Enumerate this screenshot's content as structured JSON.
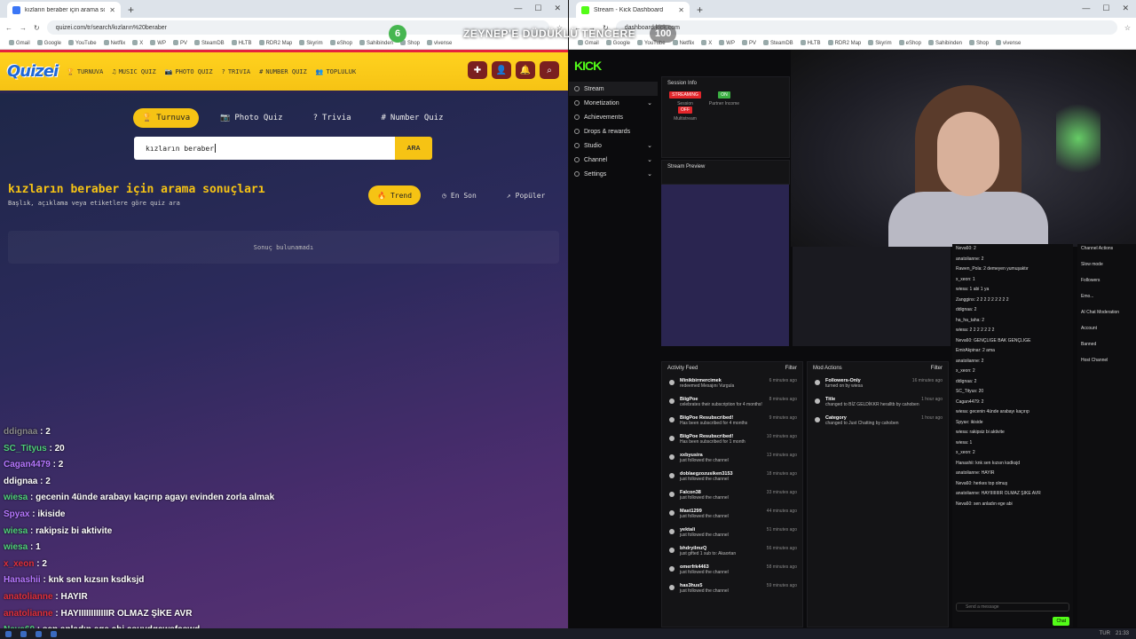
{
  "left_browser": {
    "tab_title": "kızların beraber için arama sonu...",
    "url": "quizei.com/tr/search/kızların%20beraber",
    "bookmarks": [
      "Gmail",
      "Google",
      "YouTube",
      "Netflix",
      "X",
      "WP",
      "PV",
      "SteamDB",
      "HLTB",
      "RDR2 Map",
      "Skyrim",
      "eShop",
      "Sahibinden",
      "Shop",
      "vivense"
    ]
  },
  "site": {
    "logo": "Quizei",
    "nav": [
      {
        "icon": "🏆",
        "label": "TURNUVA"
      },
      {
        "icon": "♫",
        "label": "MUSIC QUIZ"
      },
      {
        "icon": "📷",
        "label": "PHOTO QUIZ"
      },
      {
        "icon": "?",
        "label": "TRIVIA"
      },
      {
        "icon": "#",
        "label": "NUMBER QUIZ"
      },
      {
        "icon": "👥",
        "label": "TOPLULUK"
      }
    ],
    "tabs": [
      {
        "icon": "🏆",
        "label": "Turnuva",
        "active": true
      },
      {
        "icon": "📷",
        "label": "Photo Quiz",
        "active": false
      },
      {
        "icon": "?",
        "label": "Trivia",
        "active": false
      },
      {
        "icon": "#",
        "label": "Number Quiz",
        "active": false
      }
    ],
    "search_value": "kızların beraber",
    "search_button": "ARA",
    "results_title": "kızların beraber için arama sonuçları",
    "results_subtitle": "Başlık, açıklama veya etiketlere göre quiz ara",
    "sorts": [
      {
        "icon": "🔥",
        "label": "Trend",
        "active": true
      },
      {
        "icon": "◷",
        "label": "En Son",
        "active": false
      },
      {
        "icon": "↗",
        "label": "Popüler",
        "active": false
      }
    ],
    "no_results": "Sonuç bulunamadı"
  },
  "overlay": {
    "left_count": "6",
    "text": "ZEYNEP'E DÜDÜKLÜ TENCERE",
    "right_count": "100"
  },
  "chat_overlay": [
    {
      "user": "ddignaa",
      "msg": "2",
      "color": "#8a8a8a"
    },
    {
      "user": "SC_Tityus",
      "msg": "20",
      "color": "#4fd07a"
    },
    {
      "user": "Cagan4479",
      "msg": "2",
      "color": "#b677ff"
    },
    {
      "user": "ddignaa",
      "msg": "2",
      "color": "#ffffff"
    },
    {
      "user": "wiesa",
      "msg": "gecenin 4ünde arabayı kaçırıp agayı evinden zorla almak",
      "color": "#4fd07a"
    },
    {
      "user": "Spyax",
      "msg": "ikiside",
      "color": "#b677ff"
    },
    {
      "user": "wiesa",
      "msg": "rakipsiz bi aktivite",
      "color": "#4fd07a"
    },
    {
      "user": "wiesa",
      "msg": "1",
      "color": "#4fd07a"
    },
    {
      "user": "x_xeon",
      "msg": "2",
      "color": "#e0303a"
    },
    {
      "user": "Hanashii",
      "msg": "knk sen kızsın ksdksjd",
      "color": "#b677ff"
    },
    {
      "user": "anatolianne",
      "msg": "HAYIR",
      "color": "#e0303a"
    },
    {
      "user": "anatolianne",
      "msg": "HAYIIIIIIIIIIIIR OLMAZ ŞİKE AVR",
      "color": "#e0303a"
    },
    {
      "user": "Neva60",
      "msg": "sen anladın ege abi asuydqawsfaswd",
      "color": "#4fd07a"
    }
  ],
  "right_browser": {
    "tab_title": "Stream - Kick Dashboard",
    "url": "dashboard.kick.com"
  },
  "kick": {
    "logo": "KICK",
    "menu": [
      {
        "label": "Stream",
        "active": true,
        "chev": ""
      },
      {
        "label": "Monetization",
        "active": false,
        "chev": "⌄"
      },
      {
        "label": "Achievements",
        "active": false,
        "chev": ""
      },
      {
        "label": "Drops & rewards",
        "active": false,
        "chev": ""
      },
      {
        "label": "Studio",
        "active": false,
        "chev": "⌄"
      },
      {
        "label": "Channel",
        "active": false,
        "chev": "⌄"
      },
      {
        "label": "Settings",
        "active": false,
        "chev": "⌄"
      }
    ],
    "session_title": "Session Info",
    "session": [
      {
        "badge": "STREAMING",
        "color": "#e3262b",
        "label": "Session"
      },
      {
        "badge": "ON",
        "color": "#3cb043",
        "label": "Partner Income"
      },
      {
        "badge": "OFF",
        "color": "#e3262b",
        "label": "Multistream"
      }
    ],
    "preview_title": "Stream Preview",
    "activity_title": "Activity Feed",
    "mod_title": "Mod Actions",
    "filter": "Filter",
    "activity": [
      {
        "name": "Minikbirmercimek",
        "sub": "redeemed Mesajını Vurgula",
        "time": "6 minutes ago"
      },
      {
        "name": "BiigPoe",
        "sub": "celebrates their subscription for 4 months!",
        "time": "8 minutes ago"
      },
      {
        "name": "BiigPoe Resubscribed!",
        "sub": "Has been subscribed for 4 months",
        "time": "9 minutes ago"
      },
      {
        "name": "BiigPoe Resubscribed!",
        "sub": "Has been subscribed for 1 month",
        "time": "10 minutes ago"
      },
      {
        "name": "xxbyusira",
        "sub": "just followed the channel",
        "time": "13 minutes ago"
      },
      {
        "name": "doblaegzozusiken3153",
        "sub": "just followed the channel",
        "time": "18 minutes ago"
      },
      {
        "name": "Falcon38",
        "sub": "just followed the channel",
        "time": "33 minutes ago"
      },
      {
        "name": "Mast1299",
        "sub": "just followed the channel",
        "time": "44 minutes ago"
      },
      {
        "name": "yektali",
        "sub": "just followed the channel",
        "time": "51 minutes ago"
      },
      {
        "name": "bhdryilmzQ",
        "sub": "just gifted 1 sub to: Akaortan",
        "time": "56 minutes ago"
      },
      {
        "name": "omerfrk4463",
        "sub": "just followed the channel",
        "time": "58 minutes ago"
      },
      {
        "name": "has3hus5",
        "sub": "just followed the channel",
        "time": "59 minutes ago"
      }
    ],
    "mod_actions": [
      {
        "name": "Followers-Only",
        "sub": "turned on by wiesa",
        "time": "16 minutes ago"
      },
      {
        "name": "Title",
        "sub": "changed to BİZ GELDİKKR heralltb by cahoben",
        "time": "1 hour ago"
      },
      {
        "name": "Category",
        "sub": "changed to Just Chatting by cahoben",
        "time": "1 hour ago"
      }
    ],
    "chat": [
      "Neva60: 2",
      "anatolianne: 2",
      "Rawen_Pola: 2 demeyen yumuşaktır",
      "x_xeon: 1",
      "wiesa: 1 abi 1 ya",
      "Zanggins: 2 2 2 2 2 2 2 2 2",
      "ddignaa: 2",
      "ha_ha_taha: 2",
      "wiesa: 2 2 2 2 2 2 2",
      "Neva60: GENÇLİĞE BAK GENÇLİĞE",
      "EmirAkpinar: 2 ama",
      "anatolianne: 2",
      "x_xeon: 2",
      "ddignaa: 2",
      "SC_Tityus: 20",
      "Cagan4479: 2",
      "wiesa: gecenin 4ünde arabayı kaçırıp",
      "Spyax: ikiside",
      "wiesa: rakipsiz bi aktivite",
      "wiesa: 1",
      "x_xeon: 2",
      "Hanashii: knk sen kızsın ksdksjd",
      "anatolianne: HAYIR",
      "Neva60: herkes top olmuş",
      "anatolianne: HAYIIIIIIIIR OLMAZ ŞİKE AVR",
      "Neva60: sen anladın ege abi"
    ],
    "chat_placeholder": "Send a message",
    "chat_button": "Chat",
    "actions": [
      "Channel Actions",
      "Slow mode",
      "Followers",
      "Emo...",
      "AI Chat Moderation",
      "Account",
      "Banned",
      "Host Channel"
    ]
  },
  "clock": "21:33",
  "lang": "TUR"
}
